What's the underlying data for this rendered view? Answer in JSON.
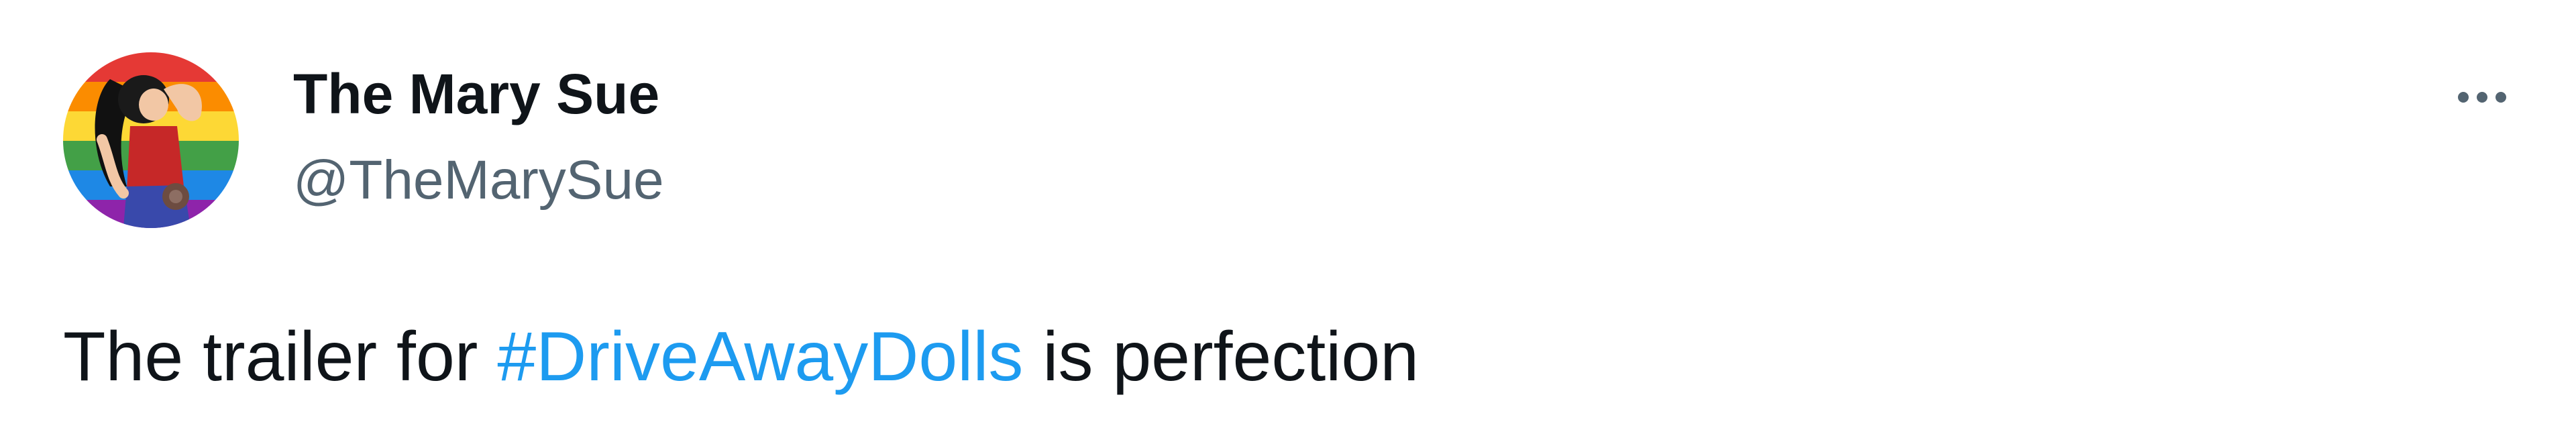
{
  "tweet": {
    "author": {
      "display_name": "The Mary Sue",
      "handle": "@TheMarySue"
    },
    "text": {
      "before": "The trailer for ",
      "hashtag": "#DriveAwayDolls",
      "after": " is perfection"
    },
    "icons": {
      "more": "more-horizontal-icon"
    },
    "colors": {
      "text": "#0f1419",
      "secondary": "#536471",
      "link": "#1d9bf0",
      "background": "#ffffff"
    }
  }
}
